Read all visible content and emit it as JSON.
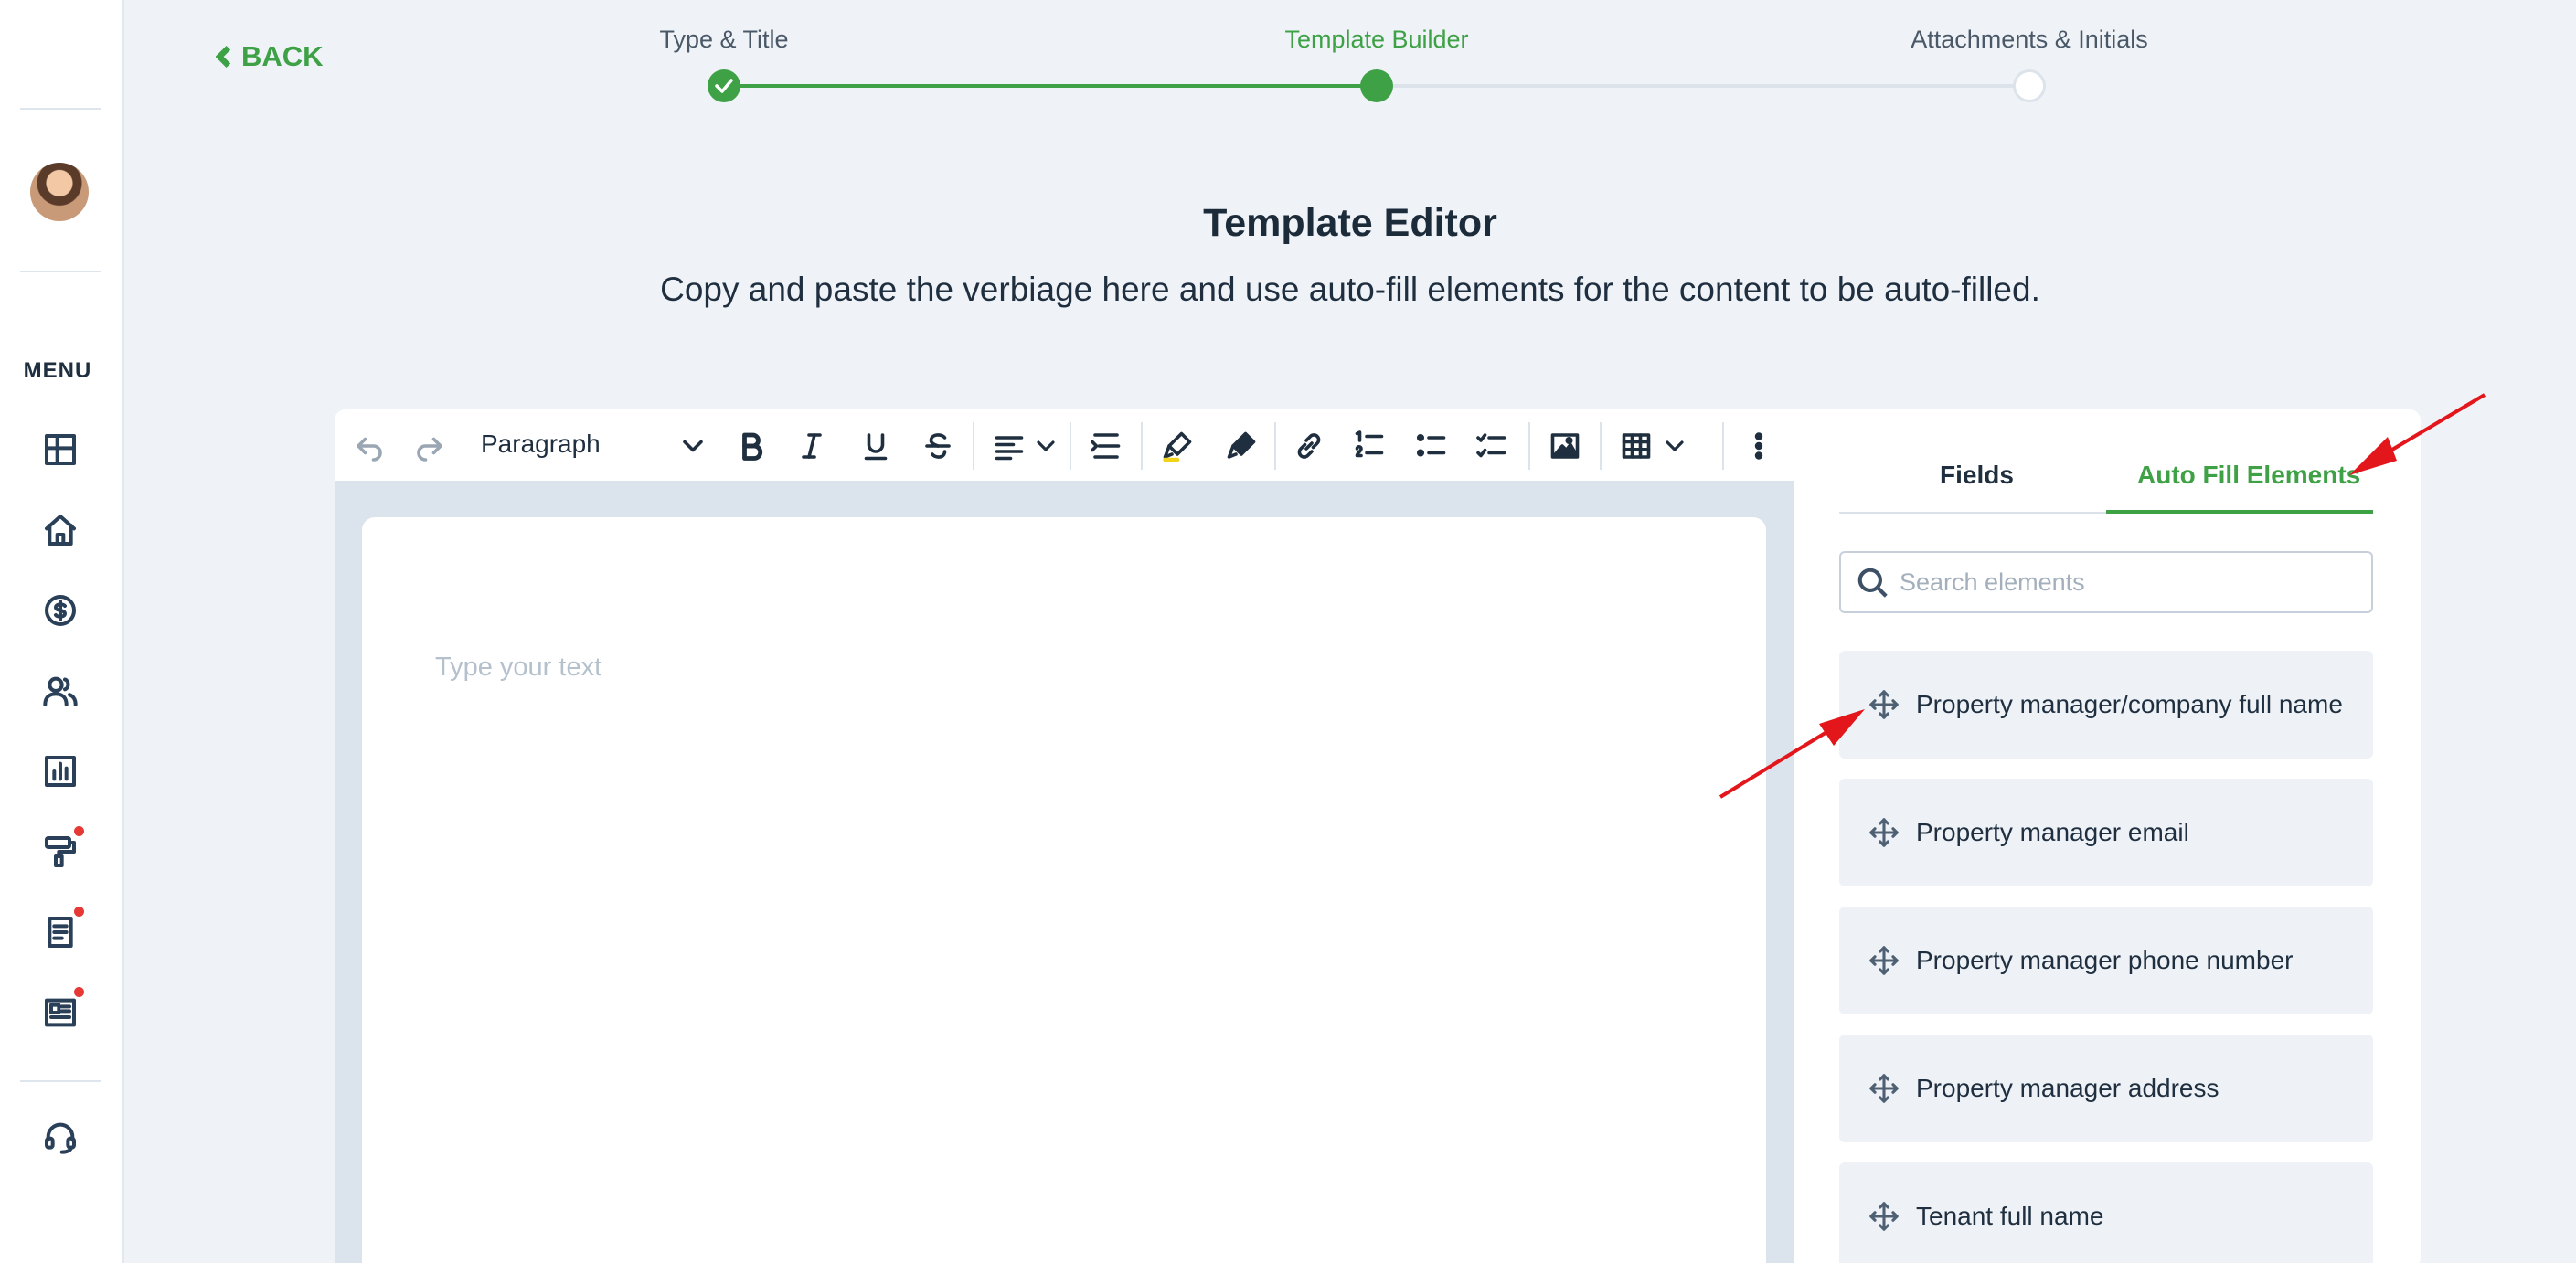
{
  "header": {
    "back_label": "BACK",
    "steps": [
      {
        "label": "Type & Title",
        "state": "complete"
      },
      {
        "label": "Template Builder",
        "state": "active"
      },
      {
        "label": "Attachments & Initials",
        "state": "pending"
      }
    ]
  },
  "sidebar": {
    "menu_label": "MENU",
    "items": [
      {
        "icon": "dashboard-icon"
      },
      {
        "icon": "home-icon"
      },
      {
        "icon": "dollar-icon"
      },
      {
        "icon": "users-icon"
      },
      {
        "icon": "chart-icon"
      },
      {
        "icon": "paint-roller-icon",
        "notification": true
      },
      {
        "icon": "document-icon",
        "notification": true
      },
      {
        "icon": "newspaper-icon",
        "notification": true
      },
      {
        "icon": "headset-icon"
      }
    ]
  },
  "main": {
    "title": "Template Editor",
    "subtitle": "Copy and paste the verbiage here and use auto-fill elements for the content to be auto-filled.",
    "editor": {
      "block_style": "Paragraph",
      "placeholder": "Type your text"
    }
  },
  "panel": {
    "tabs": [
      {
        "label": "Fields",
        "active": false
      },
      {
        "label": "Auto Fill Elements",
        "active": true
      }
    ],
    "search_placeholder": "Search elements",
    "elements": [
      "Property manager/company full name",
      "Property manager email",
      "Property manager phone number",
      "Property manager address",
      "Tenant full name"
    ]
  },
  "colors": {
    "accent": "#3ea146",
    "annotation": "#e3161b",
    "notification": "#e53935"
  }
}
